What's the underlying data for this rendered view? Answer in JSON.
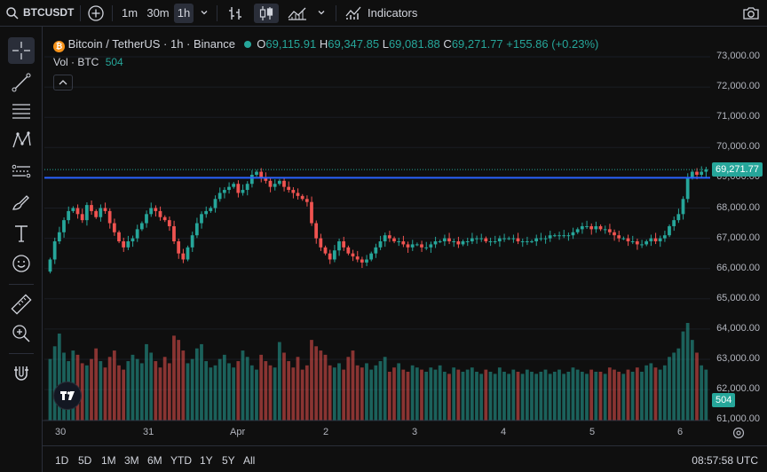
{
  "toolbar": {
    "symbol": "BTCUSDT",
    "intervals": [
      "1m",
      "30m",
      "1h"
    ],
    "active_interval": "1h",
    "indicators_label": "Indicators"
  },
  "legend": {
    "title": "Bitcoin / TetherUS · 1h · Binance",
    "o_label": "O",
    "o_value": "69,115.91",
    "h_label": "H",
    "h_value": "69,347.85",
    "l_label": "L",
    "l_value": "69,081.88",
    "c_label": "C",
    "c_value": "69,271.77",
    "change": "+155.86 (+0.23%)",
    "vol_label": "Vol · BTC",
    "vol_value": "504"
  },
  "price_axis": [
    "73,000.00",
    "72,000.00",
    "71,000.00",
    "70,000.00",
    "69,000.00",
    "68,000.00",
    "67,000.00",
    "66,000.00",
    "65,000.00",
    "64,000.00",
    "63,000.00",
    "62,000.00",
    "61,000.00"
  ],
  "price_tag": "69,271.77",
  "volume_tag": "504",
  "time_axis": [
    "30",
    "31",
    "Apr",
    "2",
    "3",
    "4",
    "5",
    "6"
  ],
  "ranges": [
    "1D",
    "5D",
    "1M",
    "3M",
    "6M",
    "YTD",
    "1Y",
    "5Y",
    "All"
  ],
  "clock": "08:57:58 UTC",
  "colors": {
    "up": "#26a69a",
    "down": "#ef5350",
    "hline": "#2962ff",
    "background": "#0f0f0f"
  },
  "chart_data": {
    "type": "candlestick",
    "interval": "1h",
    "ylim": [
      61000,
      73500
    ],
    "horizontal_line": 69000,
    "last_price": 69271.77,
    "x_start_label": "30",
    "close_series": [
      66300,
      66900,
      67200,
      67600,
      67900,
      68000,
      67800,
      67600,
      68100,
      67900,
      67700,
      68000,
      67900,
      67500,
      67200,
      66900,
      66700,
      66900,
      67000,
      67300,
      67500,
      67800,
      68000,
      67900,
      67700,
      67600,
      67400,
      66900,
      66500,
      66300,
      66700,
      67100,
      67500,
      67800,
      67900,
      68000,
      68300,
      68500,
      68600,
      68700,
      68800,
      68500,
      68600,
      68800,
      69100,
      69200,
      69000,
      68900,
      68700,
      68800,
      68900,
      68700,
      68600,
      68500,
      68400,
      68300,
      68200,
      67500,
      67000,
      66700,
      66500,
      66300,
      66600,
      66900,
      66700,
      66500,
      66400,
      66300,
      66200,
      66300,
      66500,
      66700,
      66900,
      67100,
      67000,
      66900,
      66900,
      66800,
      66700,
      66800,
      66800,
      66700,
      66700,
      66800,
      66900,
      66900,
      67000,
      66900,
      66900,
      66800,
      66900,
      66900,
      67000,
      67000,
      67000,
      66900,
      66900,
      66900,
      67000,
      67000,
      67000,
      67000,
      66900,
      66900,
      66900,
      66900,
      67000,
      67000,
      67000,
      67100,
      67100,
      67100,
      67100,
      67100,
      67200,
      67300,
      67400,
      67400,
      67300,
      67400,
      67300,
      67300,
      67200,
      67100,
      67000,
      67000,
      66900,
      66900,
      66800,
      66800,
      66900,
      67000,
      66900,
      67000,
      67100,
      67400,
      67600,
      67800,
      68300,
      69000,
      69200,
      69100,
      69200,
      69271.77
    ],
    "volume_series": [
      2900,
      3500,
      4100,
      3200,
      2800,
      3300,
      3100,
      2700,
      2600,
      2900,
      3400,
      2800,
      2500,
      3000,
      3300,
      2600,
      2400,
      2800,
      3100,
      2900,
      2700,
      3600,
      3200,
      2800,
      2500,
      3000,
      2700,
      4000,
      3800,
      3300,
      2700,
      2900,
      3400,
      3600,
      2800,
      2500,
      2600,
      2900,
      3100,
      2700,
      2500,
      2800,
      3300,
      3000,
      2600,
      2400,
      3100,
      2800,
      2600,
      2500,
      3700,
      3200,
      2800,
      2500,
      3000,
      2400,
      2600,
      3800,
      3500,
      3300,
      3100,
      2600,
      2500,
      2700,
      2400,
      3000,
      3300,
      2600,
      2500,
      2700,
      2400,
      2600,
      2800,
      3000,
      2300,
      2500,
      2700,
      2400,
      2300,
      2600,
      2500,
      2400,
      2300,
      2500,
      2400,
      2600,
      2300,
      2200,
      2500,
      2400,
      2300,
      2400,
      2500,
      2300,
      2200,
      2400,
      2300,
      2200,
      2500,
      2300,
      2200,
      2400,
      2300,
      2200,
      2400,
      2300,
      2200,
      2300,
      2400,
      2200,
      2300,
      2400,
      2200,
      2300,
      2500,
      2400,
      2300,
      2200,
      2400,
      2300,
      2300,
      2200,
      2500,
      2400,
      2300,
      2200,
      2400,
      2300,
      2500,
      2300,
      2600,
      2700,
      2500,
      2400,
      2600,
      3000,
      3200,
      3400,
      4200,
      4600,
      3800,
      3200,
      2600,
      2400
    ]
  }
}
